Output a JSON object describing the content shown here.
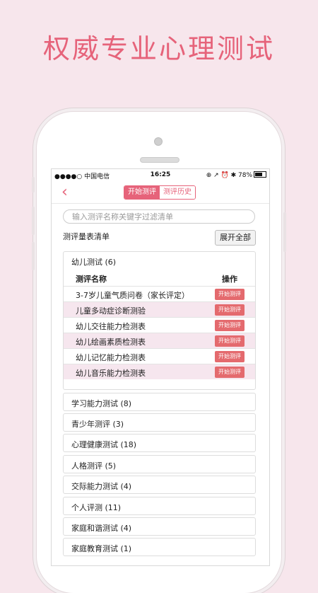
{
  "headline": "权威专业心理测试",
  "status_bar": {
    "carrier": "●●●●○ 中国电信",
    "time": "16:25",
    "right_icons": "⊕ ↗ ⏰ ✱ 78%"
  },
  "nav": {
    "back_icon": "chevron-left-icon",
    "tab_start": "开始测评",
    "tab_history": "测评历史"
  },
  "search": {
    "placeholder": "输入测评名称关键字过滤清单"
  },
  "list_title": "测评量表清单",
  "expand_all": "展开全部",
  "expanded_category": {
    "title": "幼儿测试 (6)",
    "col_name": "测评名称",
    "col_action": "操作",
    "rows": [
      {
        "name": "3-7岁儿童气质问卷（家长评定）",
        "action": "开始测评"
      },
      {
        "name": "儿童多动症诊断测验",
        "action": "开始测评"
      },
      {
        "name": "幼儿交往能力检测表",
        "action": "开始测评"
      },
      {
        "name": "幼儿绘画素质检测表",
        "action": "开始测评"
      },
      {
        "name": "幼儿记忆能力检测表",
        "action": "开始测评"
      },
      {
        "name": "幼儿音乐能力检测表",
        "action": "开始测评"
      }
    ]
  },
  "categories": [
    "学习能力测试 (8)",
    "青少年测评 (3)",
    "心理健康测试 (18)",
    "人格测评 (5)",
    "交际能力测试 (4)",
    "个人评测 (11)",
    "家庭和谐测试 (4)",
    "家庭教育测试 (1)"
  ],
  "colors": {
    "accent": "#e6637a",
    "button": "#e46a6e",
    "background": "#f7e6ec",
    "row_highlight": "#f6e6ee"
  }
}
